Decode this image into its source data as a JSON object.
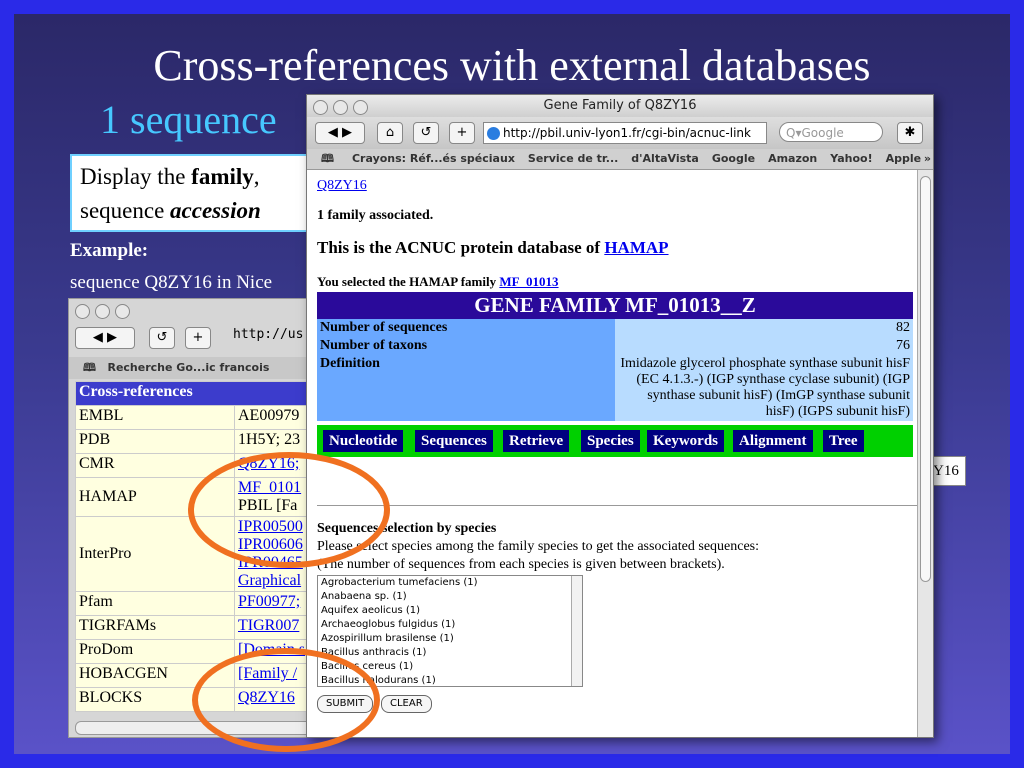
{
  "slide": {
    "title": "Cross-references with external databases",
    "subtitle": "1 sequence",
    "box_text_1": "Display the ",
    "box_bold_family": "family",
    "box_text_2": ",",
    "box_text_3": "sequence ",
    "box_bold_accession": "accession",
    "example_label": "Example:",
    "example_text": "sequence Q8ZY16 in Nice",
    "partial_right_text": "Y16"
  },
  "bg_browser": {
    "url": "http://us",
    "bookmarks": "Recherche Go...ic francois",
    "header": "Cross-references",
    "rows": [
      {
        "key": "EMBL",
        "value": "AE00979"
      },
      {
        "key": "PDB",
        "value": "1H5Y; 23"
      },
      {
        "key": "CMR",
        "value": "Q8ZY16;"
      },
      {
        "key": "HAMAP",
        "value": "MF_0101",
        "value2": "PBIL [Fa"
      },
      {
        "key": "InterPro",
        "value": "IPR00500",
        "value2": "IPR00606",
        "value3": "IPR00465",
        "value4": "Graphical"
      },
      {
        "key": "Pfam",
        "value": "PF00977;"
      },
      {
        "key": "TIGRFAMs",
        "value": "TIGR007"
      },
      {
        "key": "ProDom",
        "value": "[Domain s"
      },
      {
        "key": "HOBACGEN",
        "value": "[Family / "
      },
      {
        "key": "BLOCKS",
        "value": "Q8ZY16"
      }
    ]
  },
  "fg_browser": {
    "window_title": "Gene Family of Q8ZY16",
    "url": "http://pbil.univ-lyon1.fr/cgi-bin/acnuc-link",
    "search_placeholder": "Q▾Google",
    "bookmarks": [
      "Crayons: Réf...és spéciaux",
      "Service de tr...",
      "d'AltaVista",
      "Google",
      "Amazon",
      "Yahoo!",
      "Apple"
    ],
    "link_q8zy16": "Q8ZY16",
    "family_count": "1 family associated.",
    "db_heading": "This is the ACNUC protein database of ",
    "db_link": "HAMAP",
    "selected_text": "You selected the HAMAP family ",
    "selected_link": "MF_01013",
    "family_title": "GENE FAMILY MF_01013__Z",
    "num_seq_label": "Number of sequences",
    "num_seq_value": "82",
    "num_tax_label": "Number of taxons",
    "num_tax_value": "76",
    "def_label": "Definition",
    "def_value": "Imidazole glycerol phosphate synthase subunit hisF (EC 4.1.3.-) (IGP synthase cyclase subunit) (IGP synthase subunit hisF) (ImGP synthase subunit hisF) (IGPS subunit hisF)",
    "nav": [
      "Nucleotide",
      "Sequences",
      "Retrieve",
      "Species",
      "Keywords",
      "Alignment",
      "Tree"
    ],
    "sel_heading": "Sequences selection by species",
    "sel_line1": "Please select species among the family species to get the associated sequences:",
    "sel_line2": "(The number of sequences from each species is given between brackets).",
    "species": [
      "Agrobacterium tumefaciens (1)",
      "Anabaena sp. (1)",
      "Aquifex aeolicus (1)",
      "Archaeoglobus fulgidus (1)",
      "Azospirillum brasilense (1)",
      "Bacillus anthracis (1)",
      "Bacillus cereus (1)",
      "Bacillus halodurans (1)"
    ],
    "submit_label": "SUBMIT",
    "clear_label": "CLEAR"
  },
  "colors": {
    "accent_orange": "#f07020",
    "nav_green": "#00d000",
    "nav_blue": "#000080",
    "subtitle_cyan": "#46c8ff"
  }
}
